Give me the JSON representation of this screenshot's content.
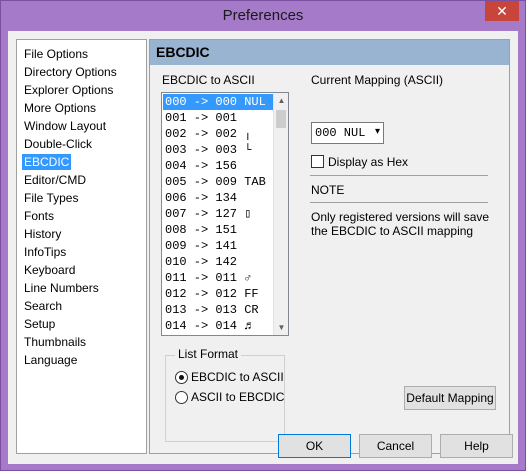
{
  "window": {
    "title": "Preferences",
    "close_label": "✕"
  },
  "nav": {
    "items": [
      "File Options",
      "Directory Options",
      "Explorer Options",
      "More Options",
      "Window Layout",
      "Double-Click",
      "EBCDIC",
      "Editor/CMD",
      "File Types",
      "Fonts",
      "History",
      "InfoTips",
      "Keyboard",
      "Line Numbers",
      "Search",
      "Setup",
      "Thumbnails",
      "Language"
    ],
    "selected": "EBCDIC"
  },
  "panel": {
    "title": "EBCDIC",
    "list_label": "EBCDIC to ASCII",
    "list_rows": [
      "000 -> 000 NUL",
      "001 -> 001",
      "002 -> 002 ╷",
      "003 -> 003 └",
      "004 -> 156",
      "005 -> 009 TAB",
      "006 -> 134",
      "007 -> 127 ▯",
      "008 -> 151",
      "009 -> 141",
      "010 -> 142",
      "011 -> 011 ♂",
      "012 -> 012 FF",
      "013 -> 013 CR",
      "014 -> 014 ♬"
    ],
    "selected_row": "000 -> 000 NUL",
    "mapping_label": "Current Mapping (ASCII)",
    "mapping_value": "000 NUL",
    "display_hex_label": "Display as Hex",
    "display_hex_checked": false,
    "note_heading": "NOTE",
    "note_line1": "Only registered versions will save",
    "note_line2": "the EBCDIC to ASCII mapping",
    "list_format": {
      "title": "List Format",
      "option1": "EBCDIC to ASCII",
      "option2": "ASCII to EBCDIC",
      "selected": "EBCDIC to ASCII"
    },
    "default_mapping_label": "Default Mapping"
  },
  "footer": {
    "ok_label": "OK",
    "cancel_label": "Cancel",
    "help_label": "Help"
  },
  "colors": {
    "frame": "#a57ac8",
    "selection": "#3399ff",
    "panel_header": "#99b4d1",
    "close_button": "#c7453b"
  }
}
